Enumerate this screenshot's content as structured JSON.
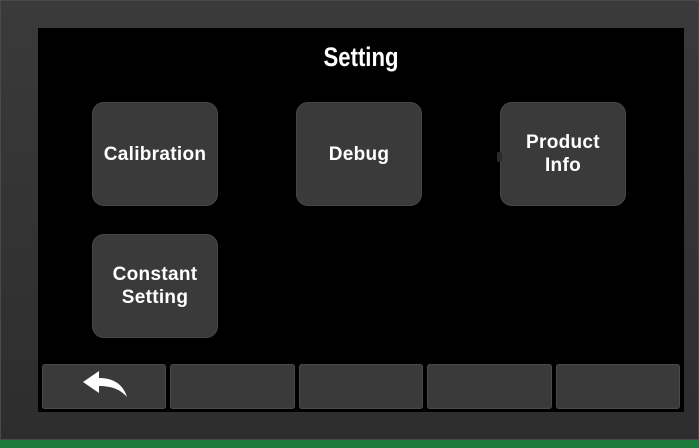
{
  "screen": {
    "title": "Setting"
  },
  "tiles": [
    {
      "label": "Calibration"
    },
    {
      "label": "Debug"
    },
    {
      "label": "Product\nInfo"
    },
    {
      "label": "Constant\nSetting"
    }
  ],
  "bottom_bar": {
    "buttons": [
      {
        "icon": "back-arrow-icon"
      },
      {
        "icon": ""
      },
      {
        "icon": ""
      },
      {
        "icon": ""
      },
      {
        "icon": ""
      }
    ]
  },
  "colors": {
    "bezel": "#2d2d2d",
    "screen_bg": "#000000",
    "tile_bg": "#3a3a3a",
    "text": "#ffffff",
    "base_green": "#1c7a3a"
  }
}
